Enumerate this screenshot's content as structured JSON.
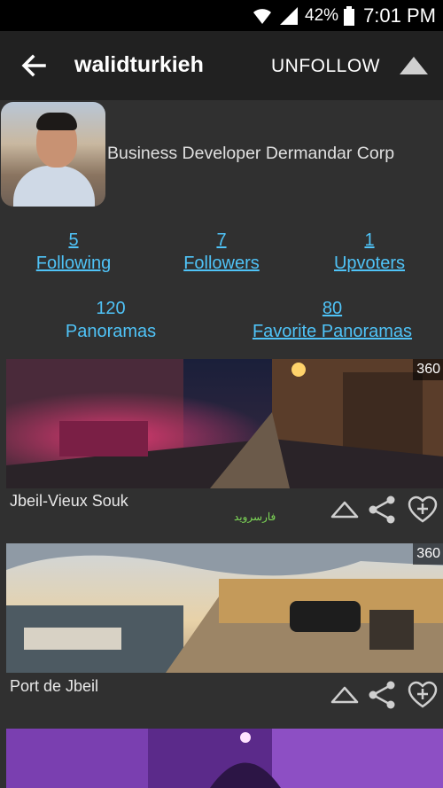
{
  "status_bar": {
    "battery": "42%",
    "time": "7:01 PM"
  },
  "app_bar": {
    "title": "walidturkieh",
    "unfollow_label": "UNFOLLOW"
  },
  "profile": {
    "bio": "Business Developer Dermandar Corp"
  },
  "stats": {
    "following": {
      "count": "5",
      "label": "Following"
    },
    "followers": {
      "count": "7",
      "label": "Followers"
    },
    "upvoters": {
      "count": "1",
      "label": "Upvoters"
    },
    "panoramas": {
      "count": "120",
      "label": "Panoramas"
    },
    "favorites": {
      "count": "80",
      "label": "Favorite Panoramas"
    }
  },
  "panoramas": [
    {
      "title": "Jbeil-Vieux Souk",
      "badge": "360"
    },
    {
      "title": "Port de Jbeil",
      "badge": "360"
    }
  ],
  "watermark": "فارسروید",
  "colors": {
    "link": "#4fc3f7",
    "background": "#303030",
    "appbar": "#212121"
  }
}
